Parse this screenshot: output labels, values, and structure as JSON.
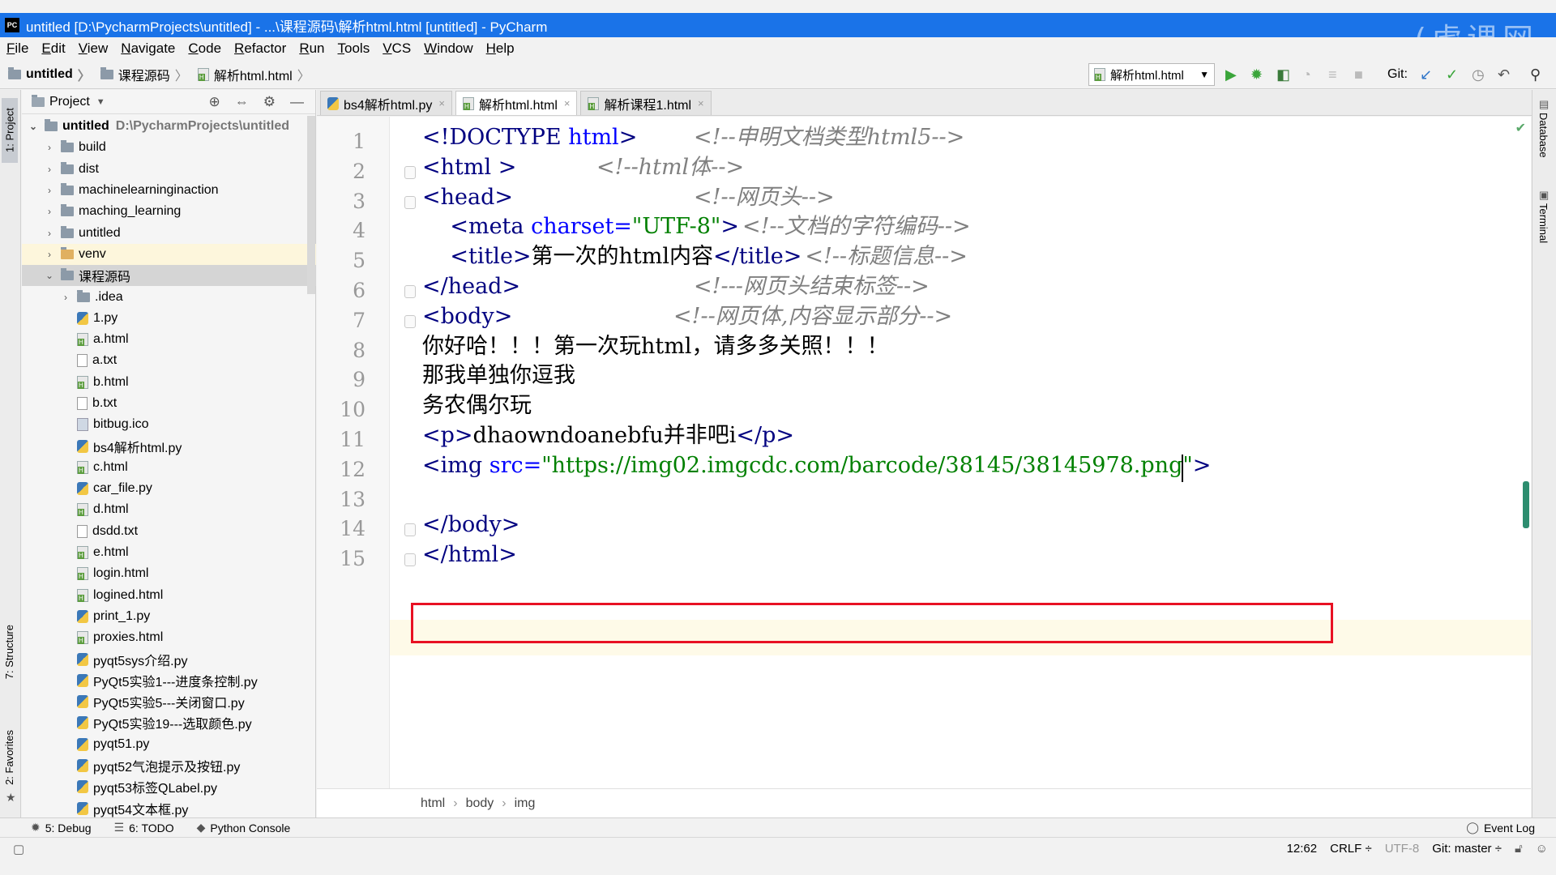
{
  "window": {
    "title": "untitled [D:\\PycharmProjects\\untitled] - ...\\课程源码\\解析html.html [untitled] - PyCharm",
    "app_icon": "pycharm-icon",
    "watermark": "(虎课网"
  },
  "menu": [
    "File",
    "Edit",
    "View",
    "Navigate",
    "Code",
    "Refactor",
    "Run",
    "Tools",
    "VCS",
    "Window",
    "Help"
  ],
  "navbar": {
    "crumbs": [
      "untitled",
      "课程源码",
      "解析html.html"
    ],
    "run_config": "解析html.html",
    "git_label": "Git:"
  },
  "left_tabs": {
    "project": "1: Project",
    "structure": "7: Structure",
    "favorites": "2: Favorites"
  },
  "project_panel": {
    "title": "Project",
    "tree": [
      {
        "name": "untitled",
        "path": "D:\\PycharmProjects\\untitled",
        "depth": 0,
        "type": "folder",
        "expanded": true
      },
      {
        "name": "build",
        "depth": 1,
        "type": "folder"
      },
      {
        "name": "dist",
        "depth": 1,
        "type": "folder"
      },
      {
        "name": "machinelearninginaction",
        "depth": 1,
        "type": "folder"
      },
      {
        "name": "maching_learning",
        "depth": 1,
        "type": "folder"
      },
      {
        "name": "untitled",
        "depth": 1,
        "type": "folder"
      },
      {
        "name": "venv",
        "depth": 1,
        "type": "folder-venv"
      },
      {
        "name": "课程源码",
        "depth": 1,
        "type": "folder",
        "expanded": true,
        "selected": true
      },
      {
        "name": ".idea",
        "depth": 2,
        "type": "folder"
      },
      {
        "name": "1.py",
        "depth": 2,
        "type": "py"
      },
      {
        "name": "a.html",
        "depth": 2,
        "type": "html"
      },
      {
        "name": "a.txt",
        "depth": 2,
        "type": "txt"
      },
      {
        "name": "b.html",
        "depth": 2,
        "type": "html"
      },
      {
        "name": "b.txt",
        "depth": 2,
        "type": "txt"
      },
      {
        "name": "bitbug.ico",
        "depth": 2,
        "type": "ico"
      },
      {
        "name": "bs4解析html.py",
        "depth": 2,
        "type": "py"
      },
      {
        "name": "c.html",
        "depth": 2,
        "type": "html"
      },
      {
        "name": "car_file.py",
        "depth": 2,
        "type": "py"
      },
      {
        "name": "d.html",
        "depth": 2,
        "type": "html"
      },
      {
        "name": "dsdd.txt",
        "depth": 2,
        "type": "txt"
      },
      {
        "name": "e.html",
        "depth": 2,
        "type": "html"
      },
      {
        "name": "login.html",
        "depth": 2,
        "type": "html"
      },
      {
        "name": "logined.html",
        "depth": 2,
        "type": "html"
      },
      {
        "name": "print_1.py",
        "depth": 2,
        "type": "py"
      },
      {
        "name": "proxies.html",
        "depth": 2,
        "type": "html"
      },
      {
        "name": "pyqt5sys介绍.py",
        "depth": 2,
        "type": "py"
      },
      {
        "name": "PyQt5实验1---进度条控制.py",
        "depth": 2,
        "type": "py"
      },
      {
        "name": "PyQt5实验5---关闭窗口.py",
        "depth": 2,
        "type": "py"
      },
      {
        "name": "PyQt5实验19---选取颜色.py",
        "depth": 2,
        "type": "py"
      },
      {
        "name": "pyqt51.py",
        "depth": 2,
        "type": "py"
      },
      {
        "name": "pyqt52气泡提示及按钮.py",
        "depth": 2,
        "type": "py"
      },
      {
        "name": "pyqt53标签QLabel.py",
        "depth": 2,
        "type": "py"
      },
      {
        "name": "pyqt54文本框.py",
        "depth": 2,
        "type": "py"
      }
    ]
  },
  "editor_tabs": [
    {
      "label": "bs4解析html.py",
      "type": "py",
      "active": false
    },
    {
      "label": "解析html.html",
      "type": "html",
      "active": true
    },
    {
      "label": "解析课程1.html",
      "type": "html",
      "active": false
    }
  ],
  "editor": {
    "lines": [
      {
        "n": "1",
        "code": "<!DOCTYPE html>",
        "comment": "<!--申明文档类型html5-->"
      },
      {
        "n": "2",
        "code": "<html >",
        "comment": "<!--html体-->"
      },
      {
        "n": "3",
        "code": "<head>",
        "comment": "<!--网页头-->"
      },
      {
        "n": "4",
        "code": "    <meta charset=\"UTF-8\">",
        "comment": "<!--文档的字符编码-->"
      },
      {
        "n": "5",
        "code": "    <title>第一次的html内容</title>",
        "comment": "<!--标题信息-->"
      },
      {
        "n": "6",
        "code": "</head>",
        "comment": "<!---网页头结束标签-->"
      },
      {
        "n": "7",
        "code": "<body>",
        "comment": "<!--网页体,内容显示部分-->"
      },
      {
        "n": "8",
        "code": "你好哈！！！第一次玩html，请多多关照！！！",
        "comment": ""
      },
      {
        "n": "9",
        "code": "那我单独你逗我",
        "comment": ""
      },
      {
        "n": "10",
        "code": "务农偶尔玩",
        "comment": ""
      },
      {
        "n": "11",
        "code": "<p>dhaowndoanebfu并非吧i</p>",
        "comment": ""
      },
      {
        "n": "12",
        "code": "<img src=\"https://img02.imgcdc.com/barcode/38145/38145978.png\">",
        "comment": ""
      },
      {
        "n": "13",
        "code": "",
        "comment": ""
      },
      {
        "n": "14",
        "code": "</body>",
        "comment": ""
      },
      {
        "n": "15",
        "code": "</html>",
        "comment": ""
      }
    ],
    "breadcrumb": [
      "html",
      "body",
      "img"
    ]
  },
  "right_tabs": {
    "database": "Database",
    "terminal": "Terminal"
  },
  "bottom_tools": {
    "debug": "5: Debug",
    "todo": "6: TODO",
    "console": "Python Console",
    "event_log": "Event Log"
  },
  "status": {
    "position": "12:62",
    "line_sep": "CRLF ÷",
    "encoding": "UTF-8",
    "git_branch": "Git: master ÷"
  }
}
